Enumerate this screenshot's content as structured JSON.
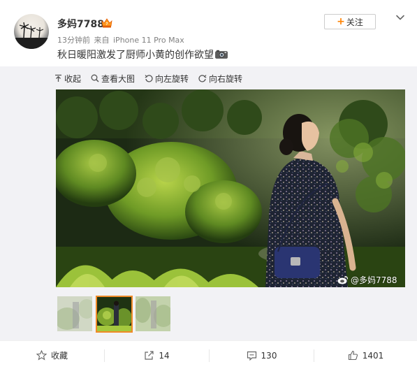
{
  "post": {
    "username": "多妈7788",
    "time": "13分钟前",
    "source_prefix": "来自",
    "device": "iPhone 11 Pro Max",
    "text": "秋日暖阳激发了厨师小黄的创作欲望",
    "follow_label": "关注",
    "follow_plus": "+"
  },
  "toolbar": {
    "collapse": "收起",
    "view_large": "查看大图",
    "rotate_left": "向左旋转",
    "rotate_right": "向右旋转"
  },
  "photo": {
    "watermark": "@多妈7788"
  },
  "thumbnails": {
    "count": 3,
    "selected_index": 1
  },
  "actions": {
    "favorite": "收藏",
    "repost_count": "14",
    "comment_count": "130",
    "like_count": "1401"
  },
  "colors": {
    "accent": "#ff8200",
    "thumb_selected_border": "#f08b28",
    "meta_text": "#808080",
    "media_bg": "#f2f2f5"
  },
  "icons": [
    "vip-crown-icon",
    "camera-emoji-icon",
    "chevron-down-icon",
    "collapse-arrow-icon",
    "magnifier-icon",
    "rotate-left-icon",
    "rotate-right-icon",
    "weibo-logo-icon",
    "star-icon",
    "share-icon",
    "comment-icon",
    "thumbs-up-icon"
  ]
}
